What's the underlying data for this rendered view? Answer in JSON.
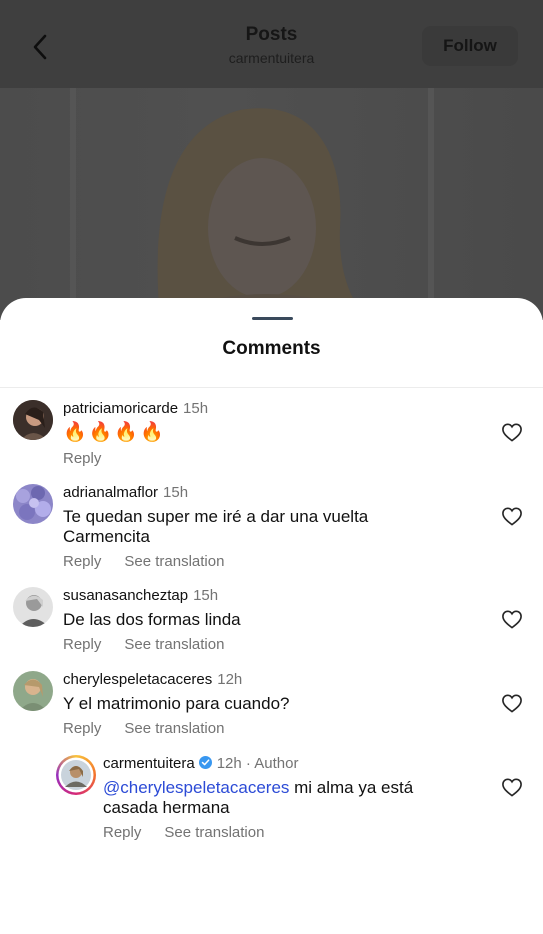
{
  "header": {
    "title": "Posts",
    "subtitle": "carmentuitera",
    "follow_label": "Follow"
  },
  "sheet": {
    "title": "Comments"
  },
  "comments": [
    {
      "username": "patriciamoricarde",
      "time": "15h",
      "text": "🔥🔥🔥🔥",
      "reply_label": "Reply"
    },
    {
      "username": "adrianalmaflor",
      "time": "15h",
      "text_line1": "Te quedan super me iré a dar una vuelta",
      "text_line2": "Carmencita",
      "reply_label": "Reply",
      "translation_label": "See translation"
    },
    {
      "username": "susanasancheztap",
      "time": "15h",
      "text": "De las dos formas linda",
      "reply_label": "Reply",
      "translation_label": "See translation"
    },
    {
      "username": "cherylespeletacaceres",
      "time": "12h",
      "text": "Y el matrimonio para cuando?",
      "reply_label": "Reply",
      "translation_label": "See translation"
    }
  ],
  "reply": {
    "username": "carmentuitera",
    "time": "12h",
    "author_tag": "· Author",
    "mention": "@cherylespeletacaceres",
    "text_line1": " mi alma ya está",
    "text_line2": "casada hermana",
    "reply_label": "Reply",
    "translation_label": "See translation"
  },
  "colors": {
    "overlay": "#4a4a4a",
    "accent_mention": "#2c4bd6",
    "verified": "#3897f0",
    "muted_text": "#737373"
  },
  "icons": {
    "back": "chevron-left-icon",
    "like": "heart-outline-icon",
    "verified": "verified-badge-icon"
  }
}
